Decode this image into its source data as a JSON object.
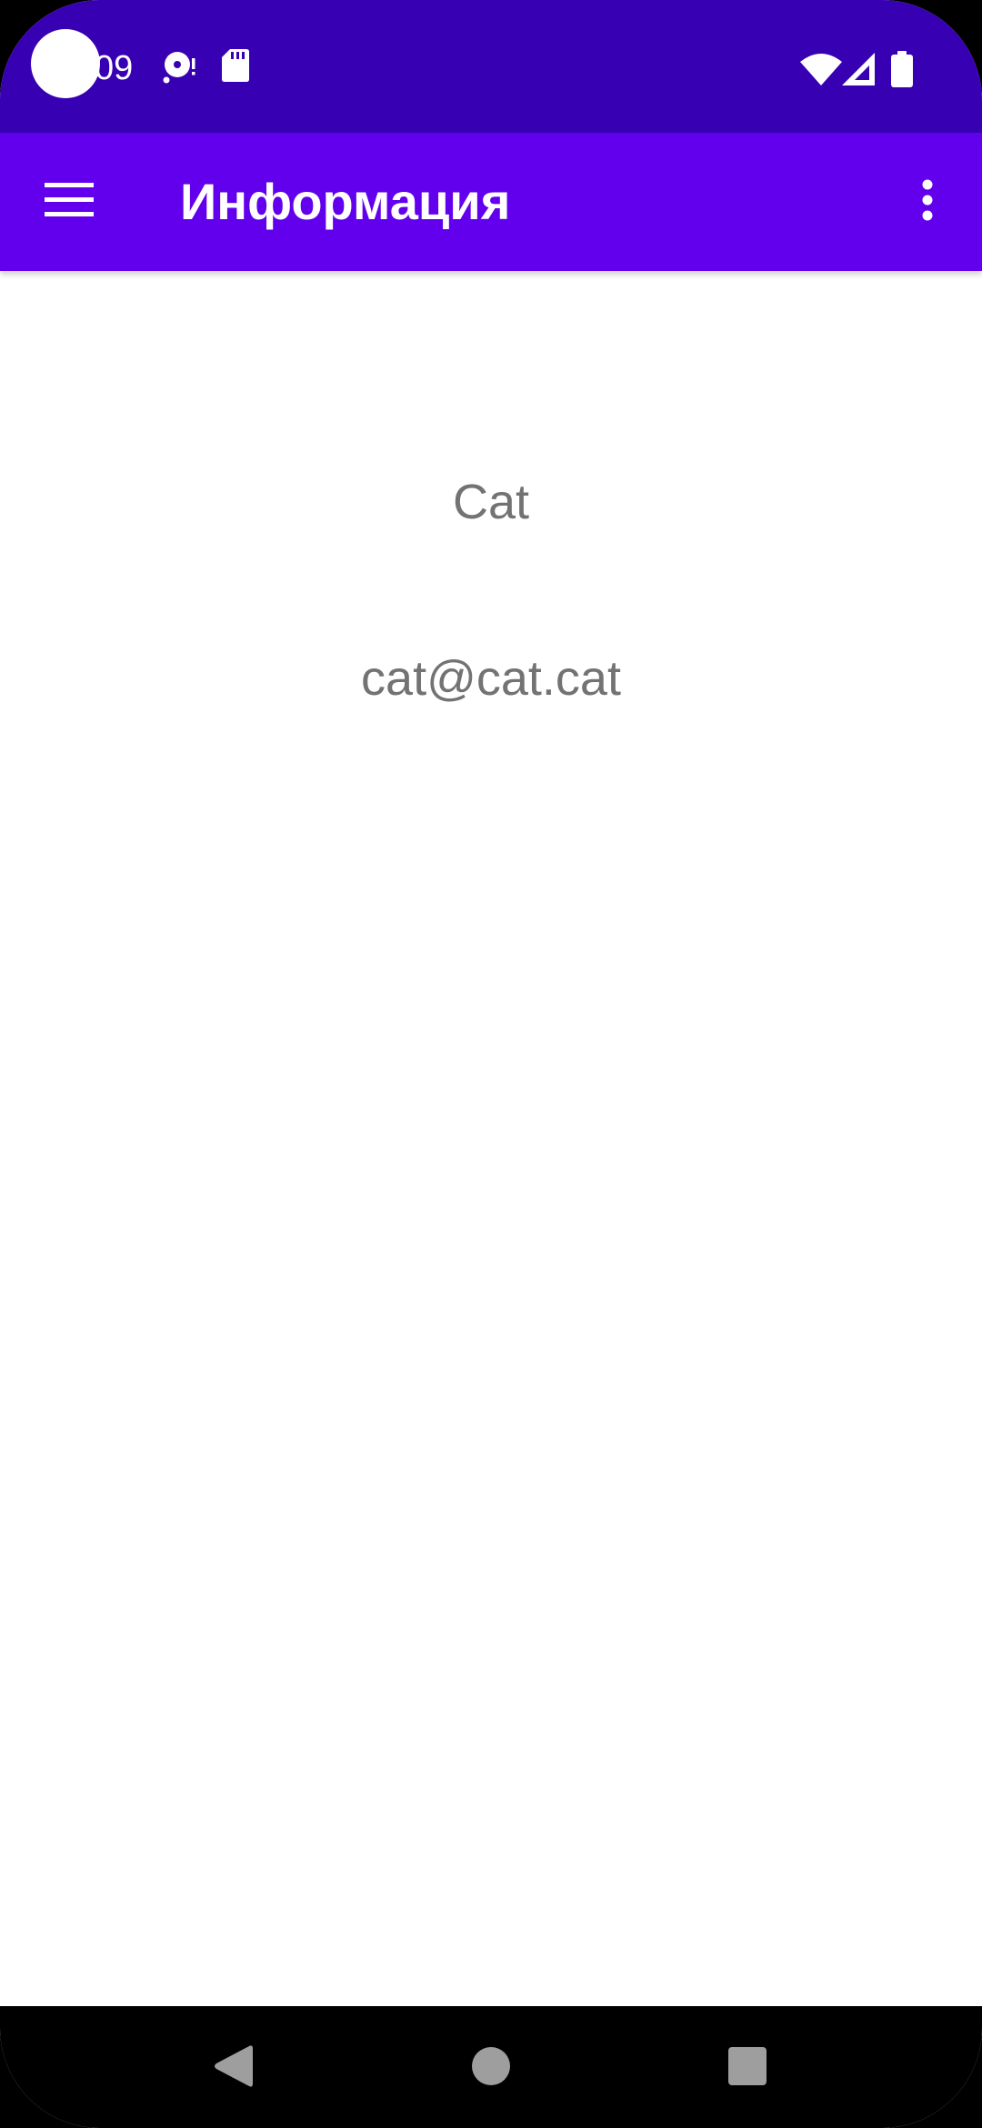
{
  "status_bar": {
    "time": "09",
    "icons": [
      "disc-alert-icon",
      "sd-card-icon",
      "wifi-icon",
      "cell-signal-icon",
      "battery-icon"
    ],
    "background": "#3700B3"
  },
  "app_bar": {
    "title": "Информация",
    "menu_icon": "hamburger-menu-icon",
    "overflow_icon": "more-vertical-icon",
    "background": "#6200EE"
  },
  "content": {
    "name": "Cat",
    "email": "cat@cat.cat",
    "text_color": "#737373"
  },
  "nav_bar": {
    "buttons": [
      "back-icon",
      "home-icon",
      "recents-icon"
    ]
  }
}
